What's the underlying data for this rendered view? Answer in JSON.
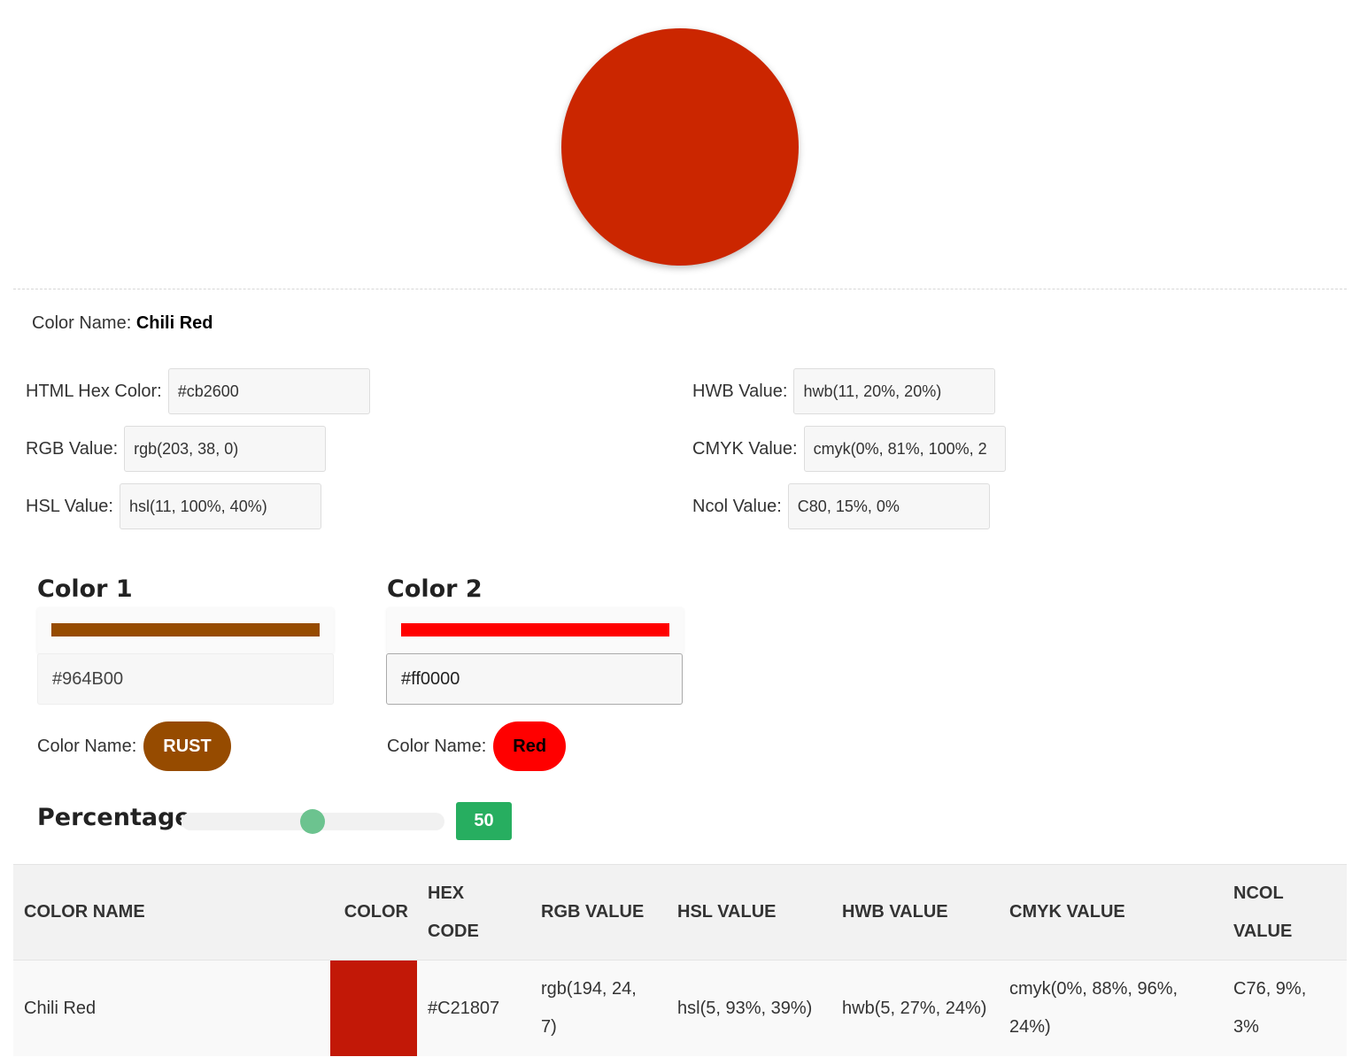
{
  "main_color": {
    "hex": "#cb2600",
    "name_label": "Color Name:",
    "name": "Chili Red"
  },
  "fields": {
    "hex": {
      "label": "HTML Hex Color:",
      "value": "#cb2600"
    },
    "rgb": {
      "label": "RGB Value:",
      "value": "rgb(203, 38, 0)"
    },
    "hsl": {
      "label": "HSL Value:",
      "value": "hsl(11, 100%, 40%)"
    },
    "hwb": {
      "label": "HWB Value:",
      "value": "hwb(11, 20%, 20%)"
    },
    "cmyk": {
      "label": "CMYK Value:",
      "value": "cmyk(0%, 81%, 100%, 2"
    },
    "ncol": {
      "label": "Ncol Value:",
      "value": "C80, 15%, 0%"
    }
  },
  "color1": {
    "title": "Color 1",
    "hex": "#964B00",
    "bar_color": "#964B00",
    "name_label": "Color Name:",
    "name": "RUST",
    "pill_bg": "#964B00",
    "pill_fg": "#ffffff"
  },
  "color2": {
    "title": "Color 2",
    "hex": "#ff0000",
    "bar_color": "#ff0000",
    "name_label": "Color Name:",
    "name": "Red",
    "pill_bg": "#ff0000",
    "pill_fg": "#000000"
  },
  "percentage": {
    "label": "Percentage",
    "value": "50",
    "fraction": 0.5
  },
  "table": {
    "headers": [
      "COLOR NAME",
      "COLOR",
      "HEX CODE",
      "RGB VALUE",
      "HSL VALUE",
      "HWB VALUE",
      "CMYK VALUE",
      "NCOL VALUE"
    ],
    "rows": [
      {
        "name": "Chili Red",
        "swatch": "#C21807",
        "hex": "#C21807",
        "rgb": "rgb(194, 24, 7)",
        "hsl": "hsl(5, 93%, 39%)",
        "hwb": "hwb(5, 27%, 24%)",
        "cmyk": "cmyk(0%, 88%, 96%, 24%)",
        "ncol": "C76, 9%, 3%"
      }
    ]
  }
}
